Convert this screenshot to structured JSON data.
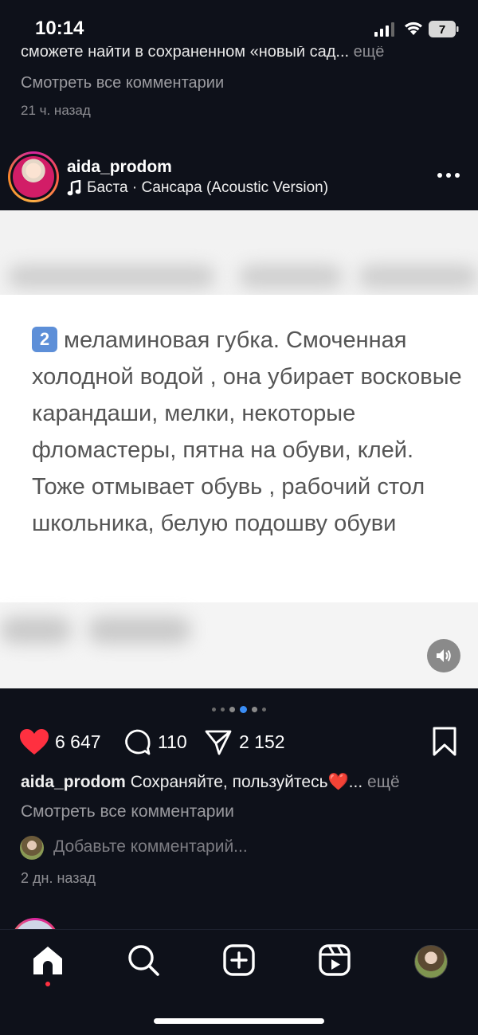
{
  "status_bar": {
    "time": "10:14",
    "battery_level": "7"
  },
  "previous_post": {
    "caption_fragment": "сможете найти в сохраненном «новый сад...",
    "caption_more": "ещё",
    "view_comments": "Смотреть все комментарии",
    "time_ago": "21 ч. назад"
  },
  "post": {
    "username": "aida_prodom",
    "music": "Баста · Сансара (Acoustic Version)",
    "media": {
      "number_badge": "2",
      "text": "меламиновая губка. Смоченная холодной водой , она убирает восковые карандаши, мелки, некоторые фломастеры,  пятна на обуви, клей. Тоже отмывает обувь , рабочий стол школьника, белую подошву обуви"
    },
    "carousel": {
      "count": 6,
      "active_index": 3
    },
    "likes": "6 647",
    "comments_count": "110",
    "shares": "2 152",
    "caption_text": "Сохраняйте, пользуйтесь",
    "caption_emoji": "❤️",
    "caption_ellipsis": "...",
    "caption_more": "ещё",
    "view_comments": "Смотреть все комментарии",
    "add_comment_placeholder": "Добавьте комментарий...",
    "time_ago": "2 дн. назад"
  },
  "colors": {
    "like_red": "#ff3040",
    "active_dot": "#3a8df5",
    "background": "#0e111a"
  },
  "tab_bar": {
    "items": [
      "home-icon",
      "search-icon",
      "create-icon",
      "reels-icon",
      "profile-avatar"
    ],
    "active": "home-icon"
  }
}
